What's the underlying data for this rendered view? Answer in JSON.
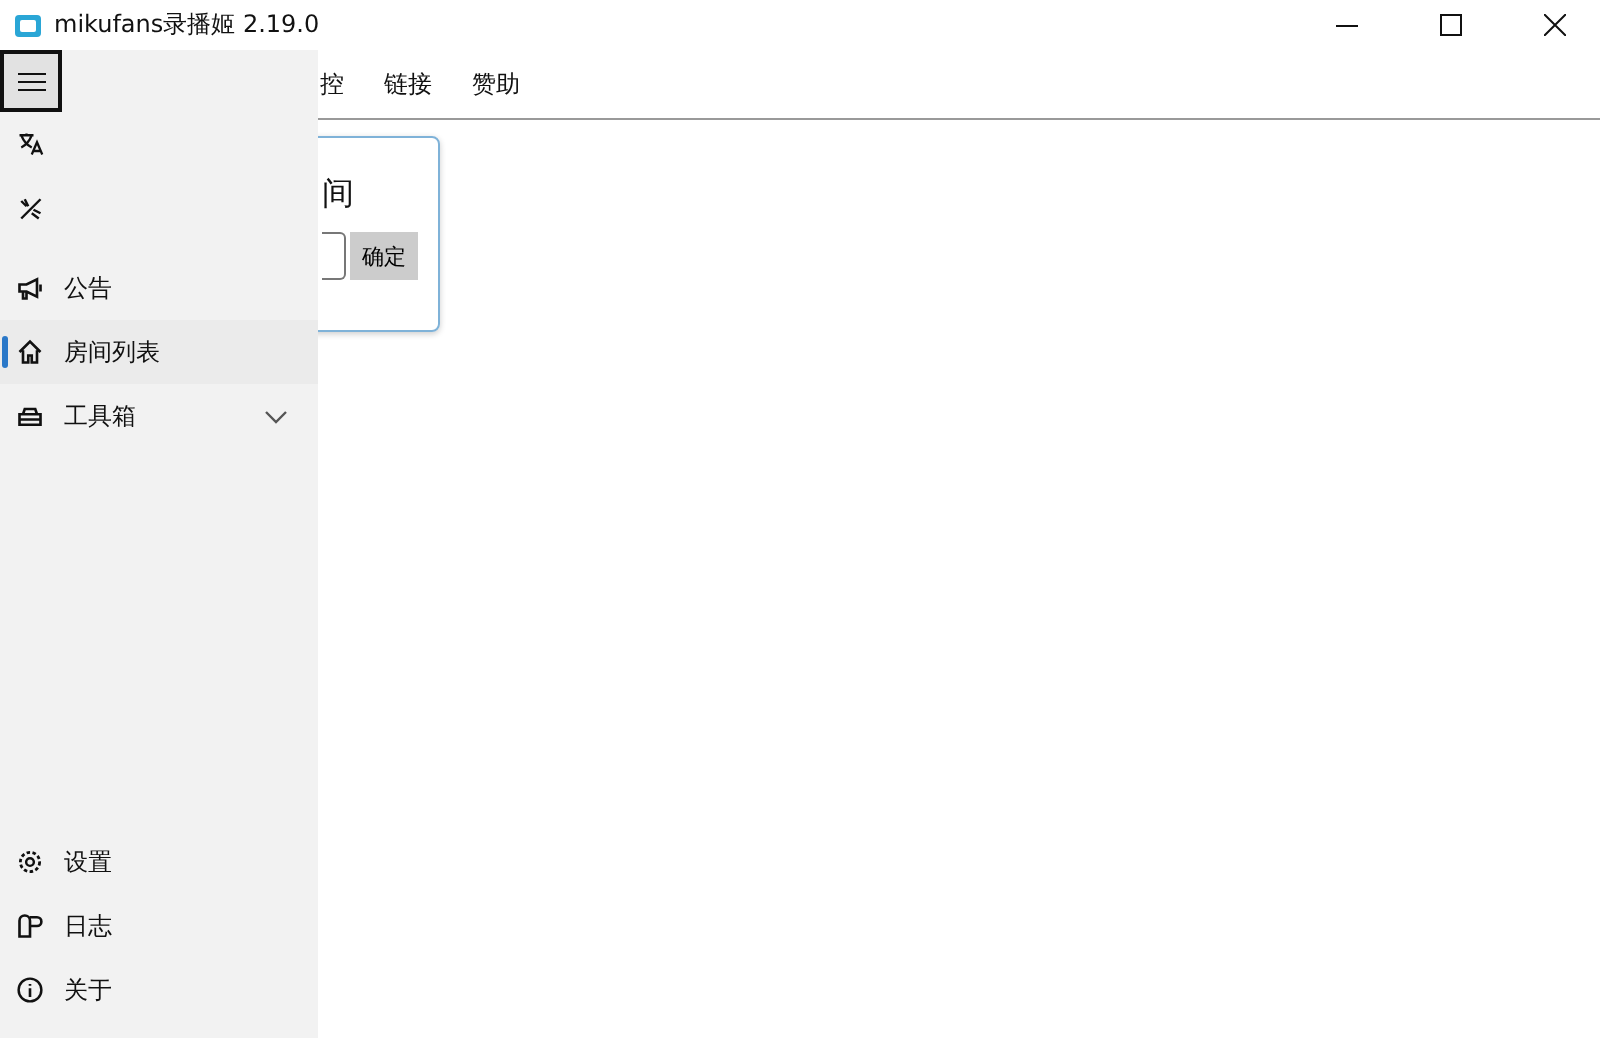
{
  "window": {
    "title": "mikufans录播姬 2.19.0"
  },
  "tabs": [
    {
      "label": "控"
    },
    {
      "label": "链接"
    },
    {
      "label": "赞助"
    }
  ],
  "card": {
    "title": "间",
    "button": "确定"
  },
  "sidebar": {
    "top_items": [
      {
        "kind": "language",
        "selected": false
      },
      {
        "kind": "theme",
        "selected": false
      },
      {
        "kind": "announce",
        "label": "公告",
        "selected": false
      },
      {
        "kind": "home",
        "label": "房间列表",
        "selected": true
      },
      {
        "kind": "toolbox",
        "label": "工具箱",
        "selected": false,
        "expanded": false
      }
    ],
    "bottom_items": [
      {
        "kind": "settings",
        "label": "设置",
        "selected": false
      },
      {
        "kind": "log",
        "label": "日志",
        "selected": false
      },
      {
        "kind": "info",
        "label": "关于",
        "selected": false
      }
    ]
  }
}
